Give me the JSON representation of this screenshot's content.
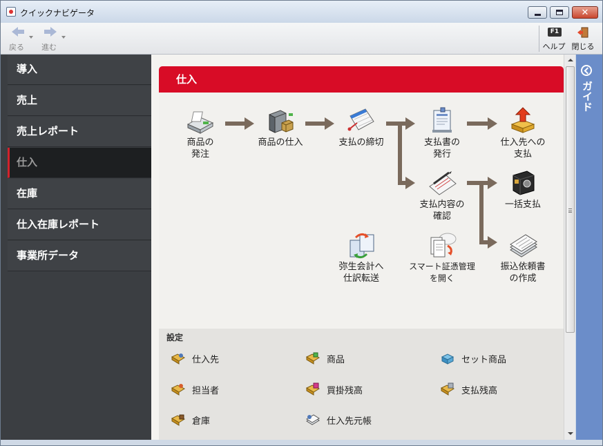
{
  "window": {
    "title": "クイックナビゲータ"
  },
  "toolbar": {
    "back_label": "戻る",
    "forward_label": "進む",
    "help_key": "F1",
    "help_label": "ヘルプ",
    "close_label": "閉じる"
  },
  "sidebar": {
    "items": [
      {
        "label": "導入"
      },
      {
        "label": "売上"
      },
      {
        "label": "売上レポート"
      },
      {
        "label": "仕入",
        "active": true
      },
      {
        "label": "在庫"
      },
      {
        "label": "仕入在庫レポート"
      },
      {
        "label": "事業所データ"
      }
    ]
  },
  "main": {
    "header": "仕入",
    "flow": [
      {
        "id": "order",
        "line1": "商品の",
        "line2": "発注",
        "icon": "fax-machine-icon"
      },
      {
        "id": "stock",
        "line1": "商品の仕入",
        "line2": "",
        "icon": "delivery-truck-icon"
      },
      {
        "id": "cutoff",
        "line1": "支払の締切",
        "line2": "",
        "icon": "calendar-icon"
      },
      {
        "id": "issue",
        "line1": "支払書の",
        "line2": "発行",
        "icon": "printed-document-icon"
      },
      {
        "id": "pay-supplier",
        "line1": "仕入先への",
        "line2": "支払",
        "icon": "payment-box-icon"
      },
      {
        "id": "confirm",
        "line1": "支払内容の",
        "line2": "確認",
        "icon": "notepad-pen-icon"
      },
      {
        "id": "bulk-pay",
        "line1": "一括支払",
        "line2": "",
        "icon": "safe-icon"
      },
      {
        "id": "yayoi",
        "line1": "弥生会計へ",
        "line2": "仕訳転送",
        "icon": "transfer-books-icon"
      },
      {
        "id": "smart",
        "line1": "スマート証憑管理",
        "line2": "を開く",
        "icon": "cloud-documents-icon"
      },
      {
        "id": "transfer",
        "line1": "振込依頼書",
        "line2": "の作成",
        "icon": "stacked-forms-icon"
      }
    ],
    "settings": {
      "title": "設定",
      "items": [
        {
          "label": "仕入先",
          "icon": "folder-supplier-icon"
        },
        {
          "label": "商品",
          "icon": "folder-product-icon"
        },
        {
          "label": "セット商品",
          "icon": "product-set-icon"
        },
        {
          "label": "担当者",
          "icon": "folder-staff-icon"
        },
        {
          "label": "買掛残高",
          "icon": "folder-payable-icon"
        },
        {
          "label": "支払残高",
          "icon": "folder-balance-icon"
        },
        {
          "label": "倉庫",
          "icon": "folder-warehouse-icon"
        },
        {
          "label": "仕入先元帳",
          "icon": "ledger-icon"
        }
      ]
    }
  },
  "guide": {
    "label": "ガイド"
  },
  "colors": {
    "header_red": "#d80c26",
    "sidebar_bg": "#3b3e42",
    "guide_blue": "#6b8dc9",
    "arrow_brown": "#7a6a5c"
  }
}
